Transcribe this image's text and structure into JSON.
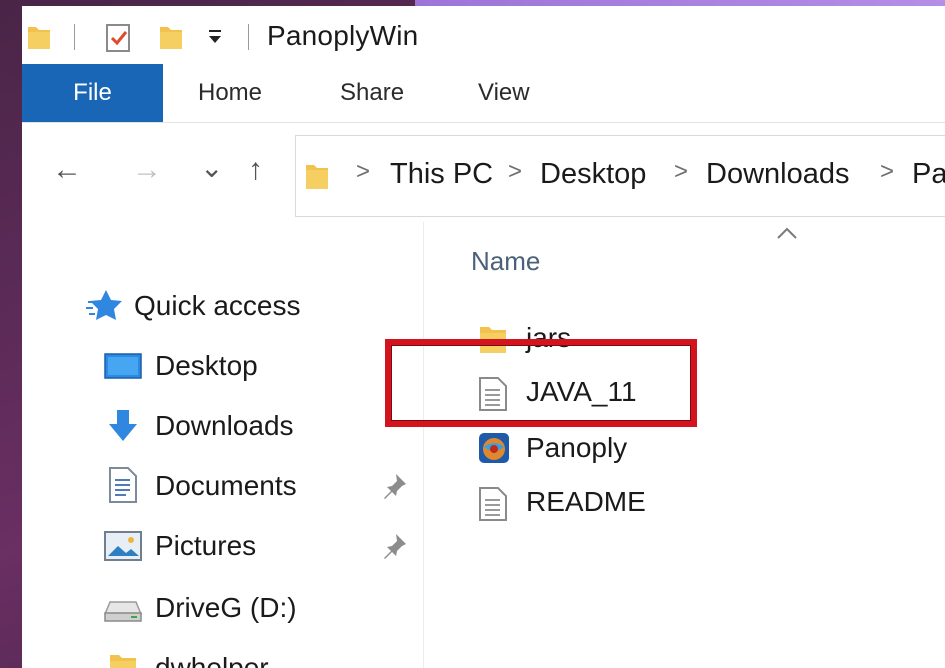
{
  "window": {
    "title": "PanoplyWin"
  },
  "quick_access_toolbar": {
    "items": [
      "folder-icon",
      "properties-check-icon",
      "new-folder-icon",
      "customize-dropdown-icon"
    ]
  },
  "ribbon": {
    "tabs": [
      {
        "label": "File",
        "active": true
      },
      {
        "label": "Home"
      },
      {
        "label": "Share"
      },
      {
        "label": "View"
      }
    ]
  },
  "navigation": {
    "back": "←",
    "forward": "→",
    "recent": "⌄",
    "up": "↑"
  },
  "address_bar": {
    "separator": ">",
    "breadcrumbs": [
      "This PC",
      "Desktop",
      "Downloads",
      "Pa"
    ]
  },
  "nav_pane": {
    "items": [
      {
        "label": "Quick access",
        "icon": "star-icon",
        "pinned": false
      },
      {
        "label": "Desktop",
        "icon": "desktop-icon",
        "pinned": false
      },
      {
        "label": "Downloads",
        "icon": "download-arrow-icon",
        "pinned": false
      },
      {
        "label": "Documents",
        "icon": "document-icon",
        "pinned": true
      },
      {
        "label": "Pictures",
        "icon": "picture-icon",
        "pinned": true
      },
      {
        "label": "DriveG (D:)",
        "icon": "drive-icon",
        "pinned": false
      },
      {
        "label": "dwhelper",
        "icon": "folder-icon",
        "pinned": false
      }
    ]
  },
  "file_list": {
    "column_header": "Name",
    "sort_indicator": "^",
    "items": [
      {
        "label": "jars",
        "icon": "folder-icon"
      },
      {
        "label": "JAVA_11",
        "icon": "text-file-icon",
        "highlighted": true
      },
      {
        "label": "Panoply",
        "icon": "panoply-app-icon"
      },
      {
        "label": "README",
        "icon": "text-file-icon"
      }
    ]
  },
  "colors": {
    "file_tab": "#1a66b6",
    "highlight_border": "#d3141f",
    "folder": "#f2c14e",
    "background_purple": "#5a2a55",
    "accent_bar": "#a57fdf"
  }
}
